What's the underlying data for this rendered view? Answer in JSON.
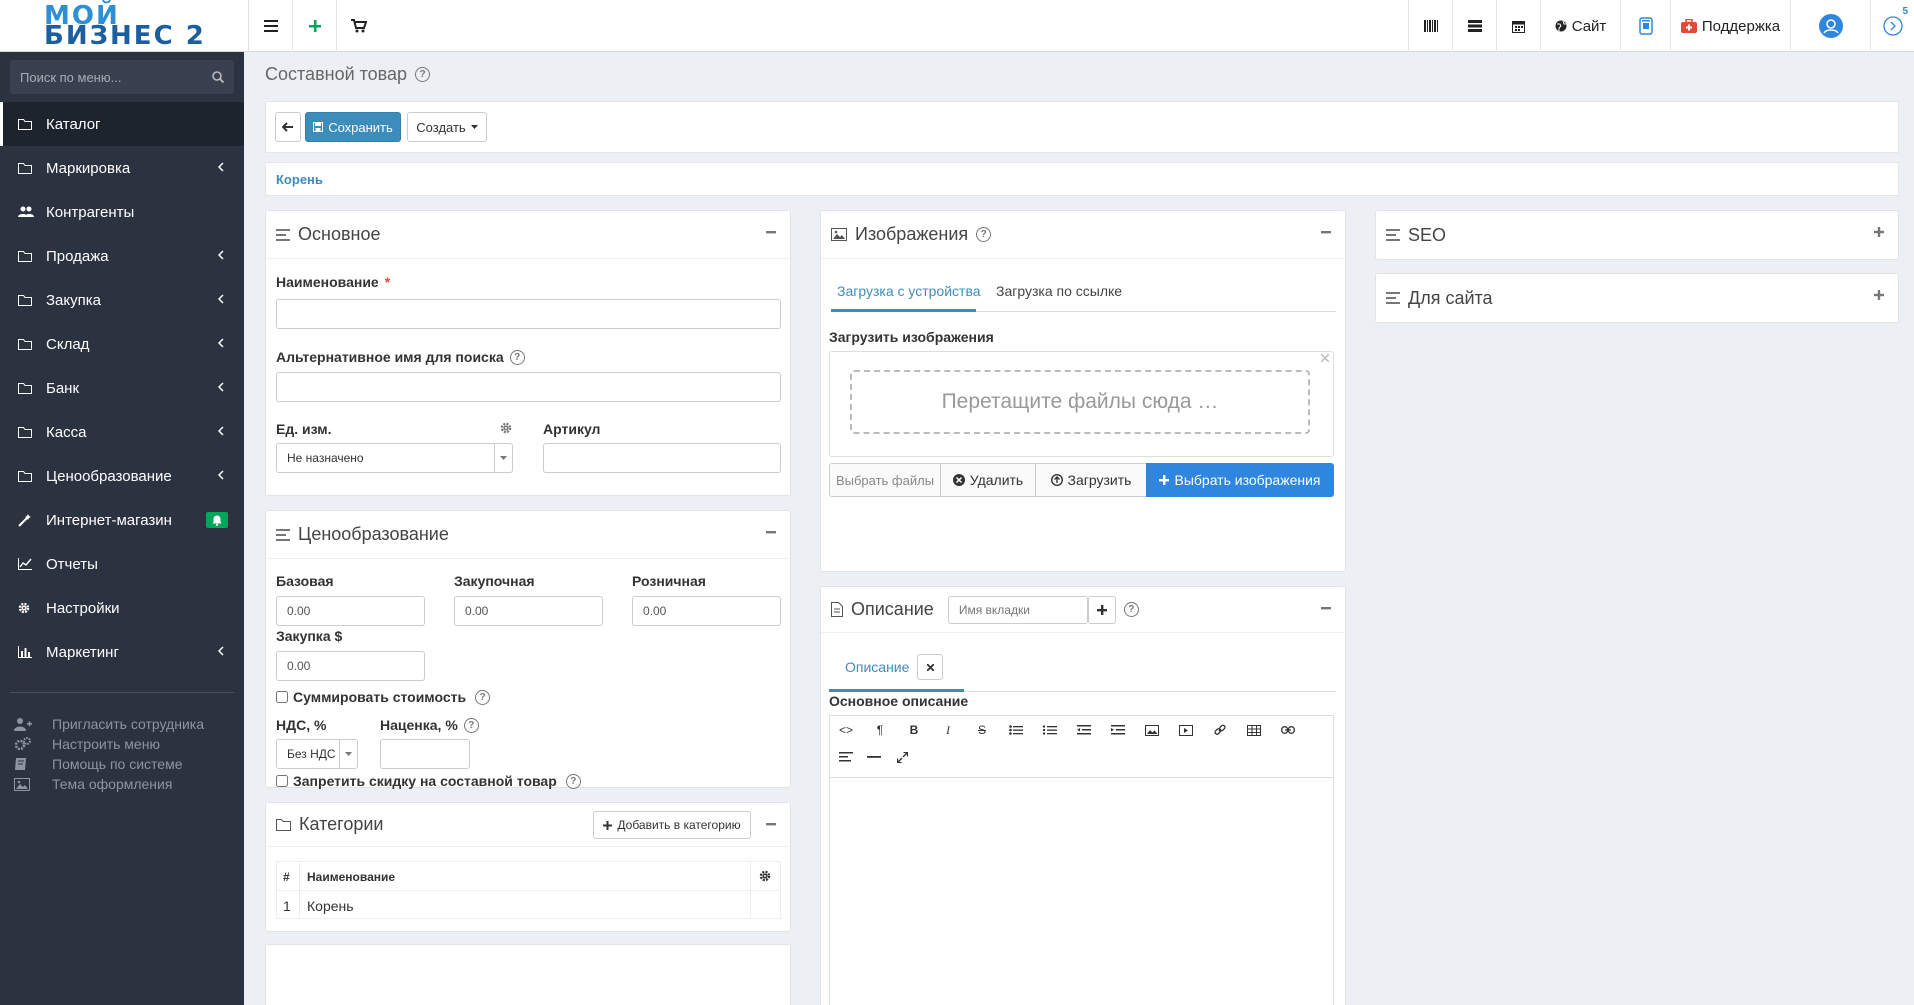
{
  "logo": {
    "line1": "МОЙ",
    "line2": "БИЗНЕС 2"
  },
  "topbar": {
    "site_label": "Сайт",
    "support_label": "Поддержка",
    "notif_count": "5"
  },
  "sidebar": {
    "search_placeholder": "Поиск по меню...",
    "items": [
      {
        "label": "Каталог",
        "icon": "folder-icon"
      },
      {
        "label": "Маркировка",
        "icon": "folder-icon"
      },
      {
        "label": "Контрагенты",
        "icon": "users-icon"
      },
      {
        "label": "Продажа",
        "icon": "folder-icon"
      },
      {
        "label": "Закупка",
        "icon": "folder-icon"
      },
      {
        "label": "Склад",
        "icon": "folder-icon"
      },
      {
        "label": "Банк",
        "icon": "folder-icon"
      },
      {
        "label": "Касса",
        "icon": "folder-icon"
      },
      {
        "label": "Ценообразование",
        "icon": "folder-icon"
      },
      {
        "label": "Интернет-магазин",
        "icon": "wand-icon"
      },
      {
        "label": "Отчеты",
        "icon": "chart-icon"
      },
      {
        "label": "Настройки",
        "icon": "gear-icon"
      },
      {
        "label": "Маркетинг",
        "icon": "chart-icon"
      }
    ],
    "links": [
      {
        "label": "Пригласить сотрудника"
      },
      {
        "label": "Настроить меню"
      },
      {
        "label": "Помощь по системе"
      },
      {
        "label": "Тема оформления"
      }
    ]
  },
  "page": {
    "title": "Составной товар",
    "save_label": "Сохранить",
    "create_label": "Создать",
    "breadcrumb": "Корень"
  },
  "basic": {
    "title": "Основное",
    "name_label": "Наименование",
    "name_required": "*",
    "alt_label": "Альтернативное имя для поиска",
    "unit_label": "Ед. изм.",
    "unit_value": "Не назначено",
    "article_label": "Артикул"
  },
  "pricing": {
    "title": "Ценообразование",
    "base_label": "Базовая",
    "base_value": "0.00",
    "purchase_label": "Закупочная",
    "purchase_value": "0.00",
    "retail_label": "Розничная",
    "retail_value": "0.00",
    "purchase_usd_label": "Закупка $",
    "purchase_usd_value": "0.00",
    "sum_label": "Суммировать стоимость",
    "vat_label": "НДС, %",
    "vat_value": "Без НДС",
    "markup_label": "Наценка, %",
    "no_discount_label": "Запретить скидку на составной товар"
  },
  "categories": {
    "title": "Категории",
    "add_label": "Добавить в категорию",
    "col_num": "#",
    "col_name": "Наименование",
    "rows": [
      {
        "num": "1",
        "name": "Корень"
      }
    ]
  },
  "images": {
    "title": "Изображения",
    "tab_device": "Загрузка с устройства",
    "tab_link": "Загрузка по ссылке",
    "upload_label": "Загрузить изображения",
    "drop_text": "Перетащите файлы сюда …",
    "choose_files": "Выбрать файлы",
    "delete": "Удалить",
    "upload": "Загрузить",
    "choose_images": "Выбрать изображения"
  },
  "description": {
    "title": "Описание",
    "tab_name_placeholder": "Имя вкладки",
    "tab_label": "Описание",
    "main_label": "Основное описание"
  },
  "seo": {
    "title": "SEO"
  },
  "for_site": {
    "title": "Для сайта"
  },
  "colors": {
    "primary": "#3c8dbc",
    "sidebar": "#2b3240",
    "bright_blue": "#2e86de"
  }
}
